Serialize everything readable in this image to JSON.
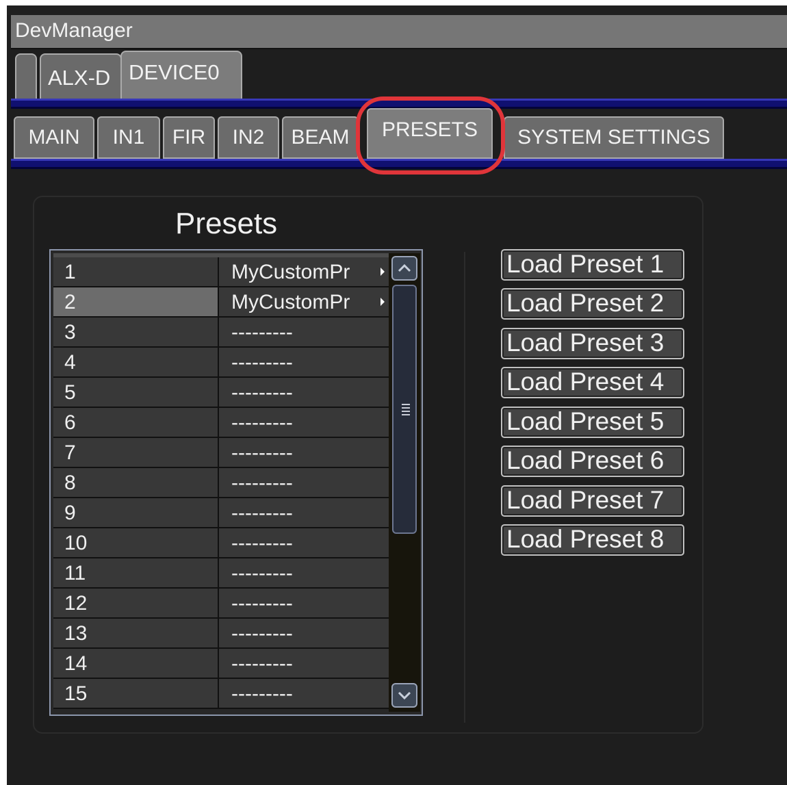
{
  "window": {
    "title": "DevManager"
  },
  "device_tabs": [
    {
      "label": ""
    },
    {
      "label": "ALX-D"
    },
    {
      "label": "DEVICE0",
      "active": true
    }
  ],
  "page_tabs": [
    {
      "label": "MAIN"
    },
    {
      "label": "IN1"
    },
    {
      "label": "FIR"
    },
    {
      "label": "IN2"
    },
    {
      "label": "BEAM"
    },
    {
      "label": "PRESETS",
      "active": true
    },
    {
      "label": "SYSTEM SETTINGS"
    }
  ],
  "presets_panel": {
    "title": "Presets",
    "rows": [
      {
        "number": "1",
        "name": "MyCustomPr"
      },
      {
        "number": "2",
        "name": "MyCustomPr",
        "selected": true
      },
      {
        "number": "3",
        "name": "---------"
      },
      {
        "number": "4",
        "name": "---------"
      },
      {
        "number": "5",
        "name": "---------"
      },
      {
        "number": "6",
        "name": "---------"
      },
      {
        "number": "7",
        "name": "---------"
      },
      {
        "number": "8",
        "name": "---------"
      },
      {
        "number": "9",
        "name": "---------"
      },
      {
        "number": "10",
        "name": "---------"
      },
      {
        "number": "11",
        "name": "---------"
      },
      {
        "number": "12",
        "name": "---------"
      },
      {
        "number": "13",
        "name": "---------"
      },
      {
        "number": "14",
        "name": "---------"
      },
      {
        "number": "15",
        "name": "---------"
      }
    ],
    "load_buttons": [
      {
        "label": "Load Preset 1"
      },
      {
        "label": "Load Preset 2"
      },
      {
        "label": "Load Preset 3"
      },
      {
        "label": "Load Preset 4"
      },
      {
        "label": "Load Preset 5"
      },
      {
        "label": "Load Preset 6"
      },
      {
        "label": "Load Preset 7"
      },
      {
        "label": "Load Preset 8"
      }
    ]
  },
  "colors": {
    "highlight": "#e0353a",
    "accent_bar": "#101070"
  }
}
